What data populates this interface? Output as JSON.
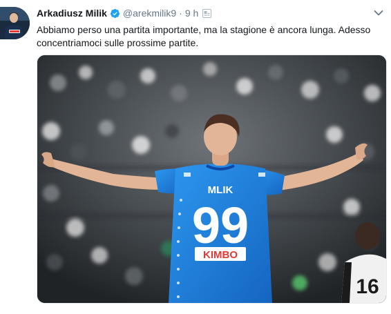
{
  "tweet": {
    "author_name": "Arkadiusz Milik",
    "handle": "@arekmilik9",
    "separator": "·",
    "time": "9 h",
    "text": "Abbiamo perso una partita importante, ma la stagione è ancora lunga. Adesso concentriamoci sulle prossime partite."
  },
  "photo": {
    "jersey_name": "MLIK",
    "jersey_number": "99",
    "sponsor": "KIMBO",
    "bg_player_number": "16"
  },
  "icons": {
    "verified": "verified-badge-icon",
    "translate": "translate-icon",
    "menu": "chevron-down-icon"
  },
  "colors": {
    "verified": "#1da1f2",
    "secondary_text": "#657786",
    "jersey": "#1e88e5",
    "sponsor": "#e53935"
  }
}
